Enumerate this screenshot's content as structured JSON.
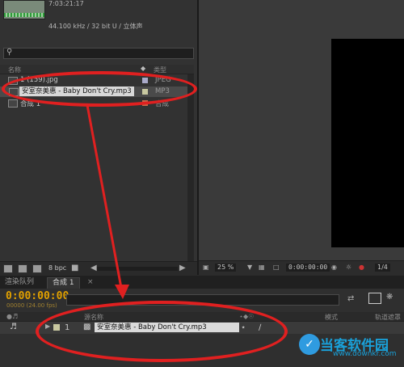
{
  "project": {
    "info_line1": "7:03:21:17",
    "info_line2": "44.100 kHz / 32 bit U / 立体声",
    "search_placeholder": "",
    "col_name": "名称",
    "col_type": "类型",
    "items": [
      {
        "name": "1 (159).jpg",
        "type": "JPEG",
        "label_color": "#a9a9c8"
      },
      {
        "name": "安室奈美惠 - Baby Don't Cry.mp3",
        "type": "MP3",
        "label_color": "#c8c8a0"
      },
      {
        "name": "合成 1",
        "type": "合成",
        "label_color": "#c86a4a"
      }
    ],
    "bpc": "8 bpc"
  },
  "viewer": {
    "zoom": "25 %",
    "time": "0:00:00:00",
    "resolution": "1/4"
  },
  "timeline": {
    "tab_render": "渲染队列",
    "tab_comp": "合成 1",
    "timecode": "0:00:00:00",
    "fps": "00000 (24.00 fps)",
    "col_source": "源名称",
    "col_mode": "模式",
    "col_trkmat": "轨道遮罩",
    "layer_index": "1",
    "layer_name": "安室奈美惠 - Baby Don't Cry.mp3"
  },
  "watermark": {
    "title": "当客软件园",
    "url": "www.downkr.com"
  },
  "colors": {
    "timecode": "#e0a000",
    "annotation": "#e02020",
    "watermark": "#1aa0d8"
  }
}
